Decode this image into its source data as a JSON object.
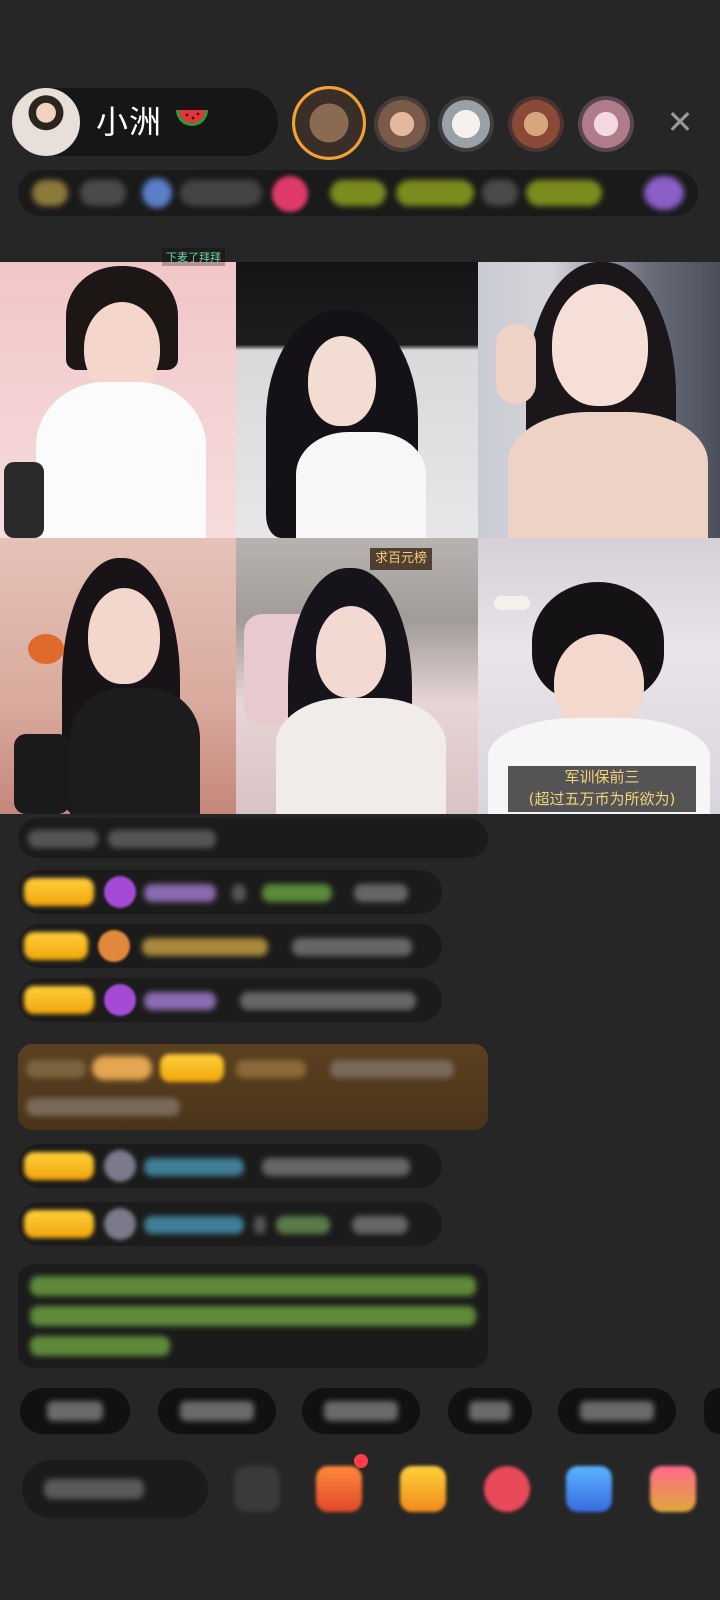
{
  "header": {
    "host_name": "小洲",
    "host_emoji": "watermelon-emoji",
    "close_icon": "close-icon"
  },
  "video_tiles": [
    {
      "caption": "下麦了拜拜"
    },
    {
      "caption": ""
    },
    {
      "caption": ""
    },
    {
      "caption": ""
    },
    {
      "caption": "求百元榜"
    },
    {
      "caption_line1": "军训保前三",
      "caption_line2": "(超过五万币为所欲为)"
    }
  ],
  "colors": {
    "background": "#262626",
    "badge_gold": "#f2a60c",
    "caption_gold": "#f4d27a",
    "caption_green": "#6cd6a0",
    "username_cyan": "#4fb6d8",
    "username_purple": "#b38ad6",
    "notice_green": "#8bc34a"
  }
}
